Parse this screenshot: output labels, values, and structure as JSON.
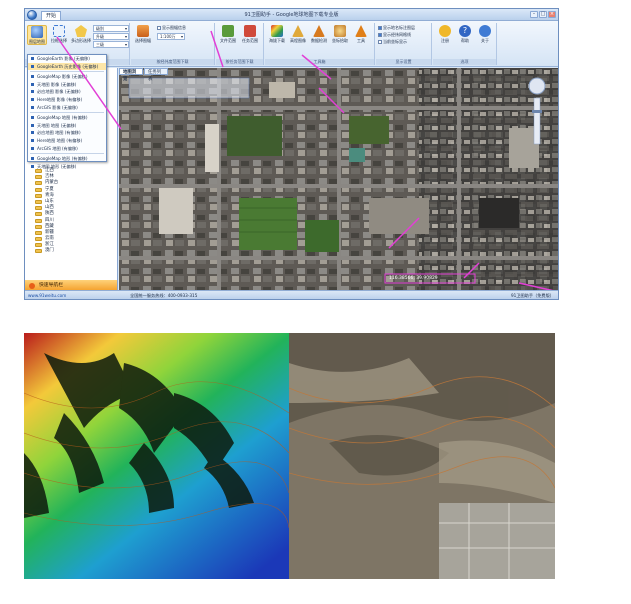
{
  "window": {
    "start_tab": "开始",
    "title": "91卫图助手 - Google地球地图下载专业版"
  },
  "ribbon": {
    "buttons": [
      {
        "label": "图层地图",
        "color": "#3f7bd4"
      },
      {
        "label": "拉框选择",
        "color": "#8fb3e6"
      },
      {
        "label": "多边形选择",
        "color": "#f2c84b"
      },
      {
        "label": "选择图幅",
        "color": "#c9601a"
      },
      {
        "label": "文件范围",
        "color": "#5a9b3b"
      },
      {
        "label": "任务范围",
        "color": "#d04a3a"
      },
      {
        "label": "海拔下载",
        "color": "#2f9a4c"
      },
      {
        "label": "高程图像",
        "color": "#e0a93a"
      },
      {
        "label": "数据检测",
        "color": "#d77a1e"
      },
      {
        "label": "坐标拾取",
        "color": "#c07928"
      },
      {
        "label": "工具",
        "color": "#e07f18"
      },
      {
        "label": "注册",
        "color": "#f0b82a"
      },
      {
        "label": "帮助",
        "color": "#3267c4"
      },
      {
        "label": "关于",
        "color": "#3f7bd4"
      }
    ],
    "combos": [
      "级别",
      "升级",
      "三级"
    ],
    "checks": {
      "show_map_info": "显示图幅信息",
      "scale": "1:100万",
      "show_overlay": "显示地名标注图层",
      "show_grid": "显示经纬网格线",
      "show_coords": "当前坐标显示"
    },
    "groups": [
      "按行政区划下载",
      "按经纬度范围下载",
      "按任务范围下载",
      "工具箱",
      "显示设置",
      "选项"
    ]
  },
  "dropdown": {
    "items": [
      {
        "label": "GoogleEarth 影像 (无偏移)",
        "selected": false
      },
      {
        "label": "GoogleEarth 历史影像 (无偏移)",
        "selected": true
      },
      {
        "sep": true
      },
      {
        "label": "GoogleMap 影像 (无偏移)",
        "selected": false
      },
      {
        "label": "天地图 影像 (无偏移)",
        "selected": false
      },
      {
        "label": "必应地图 影像 (无偏移)",
        "selected": false
      },
      {
        "label": "Here地图 影像 (有偏移)",
        "selected": false
      },
      {
        "label": "ArcGIS 影像 (无偏移)",
        "selected": false
      },
      {
        "sep": true
      },
      {
        "label": "GoogleMap 地图 (有偏移)",
        "selected": false
      },
      {
        "label": "天地图 地图 (无偏移)",
        "selected": false
      },
      {
        "label": "必应地图 地图 (有偏移)",
        "selected": false
      },
      {
        "label": "Here地图 地图 (有偏移)",
        "selected": false
      },
      {
        "label": "ArcGIS 地图 (有偏移)",
        "selected": false
      },
      {
        "sep": true
      },
      {
        "label": "GoogleMap 地形 (有偏移)",
        "selected": false
      },
      {
        "label": "天地图 地形 (无偏移)",
        "selected": false
      }
    ]
  },
  "tree": {
    "items": [
      "江西",
      "吉林",
      "内蒙古",
      "宁夏",
      "青海",
      "山东",
      "山西",
      "陕西",
      "四川",
      "西藏",
      "新疆",
      "云南",
      "浙江",
      "澳门"
    ]
  },
  "panel": {
    "footer": "快速导航栏"
  },
  "map": {
    "tabs": [
      "地图浏览",
      "任务列表"
    ],
    "coords": "116.38566, 39.90829",
    "status_left": "www.91weitu.com",
    "status_mid": "全国统一服务热线：400-0933-315",
    "status_right": "91卫图助手（免费版）"
  },
  "annotation_color": "#e23fd6"
}
